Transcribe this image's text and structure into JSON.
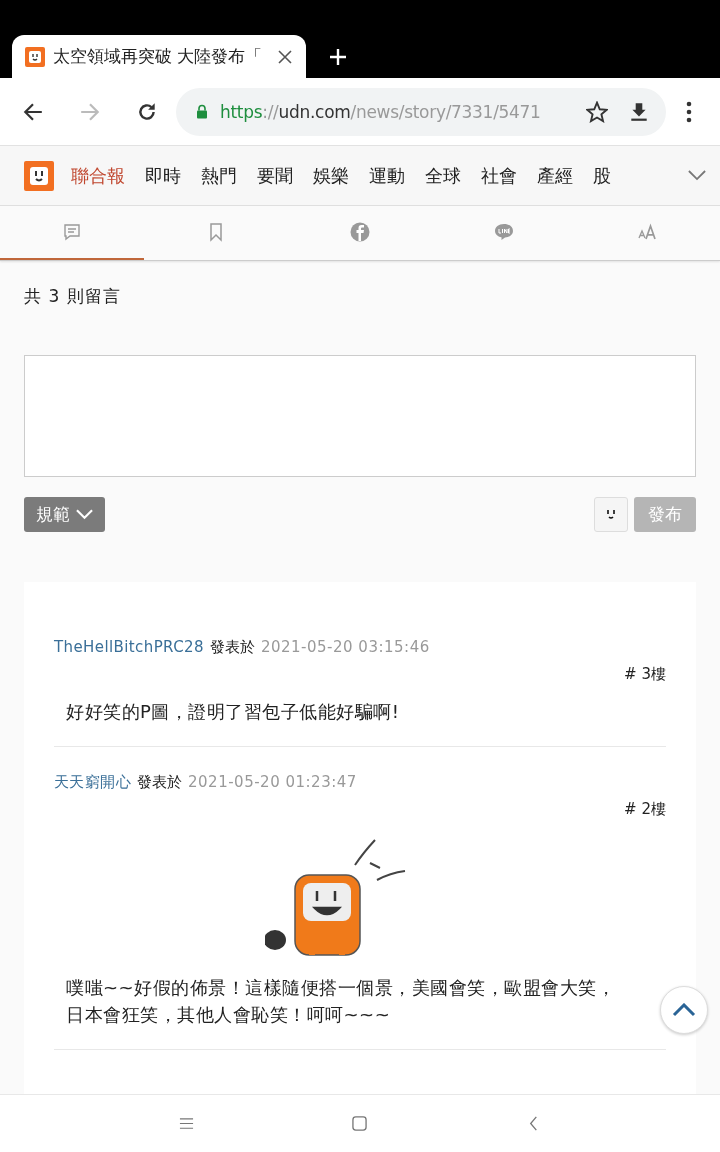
{
  "browser_tab": {
    "title": "太空領域再突破 大陸發布「"
  },
  "address_bar": {
    "scheme": "https",
    "separator": "://",
    "host": "udn.com",
    "path": "/news/story/7331/5471"
  },
  "site_nav": {
    "brand": "聯合報",
    "items": [
      "即時",
      "熱門",
      "要聞",
      "娛樂",
      "運動",
      "全球",
      "社會",
      "產經",
      "股"
    ]
  },
  "icon_tabs": [
    {
      "kind": "comment",
      "selected": true
    },
    {
      "kind": "bookmark",
      "selected": false
    },
    {
      "kind": "facebook",
      "selected": false
    },
    {
      "kind": "line",
      "selected": false
    },
    {
      "kind": "font-size",
      "selected": false
    }
  ],
  "comment_count": "共 3 則留言",
  "comment_box": {
    "rules_button": "規範",
    "post_button": "發布",
    "post_disabled": true
  },
  "comments": [
    {
      "author": "TheHellBitchPRC28",
      "posted_label": "發表於",
      "time": "2021-05-20 03:15:46",
      "floor": "# 3樓",
      "sticker": false,
      "text": "好好笑的P圖，證明了習包子低能好騙啊!"
    },
    {
      "author": "天天窮開心",
      "posted_label": "發表於",
      "time": "2021-05-20 01:23:47",
      "floor": "# 2樓",
      "sticker": true,
      "text": "噗嗤~~好假的佈景！這樣隨便搭一個景，美國會笑，歐盟會大笑，日本會狂笑，其他人會恥笑！呵呵~~~"
    }
  ]
}
